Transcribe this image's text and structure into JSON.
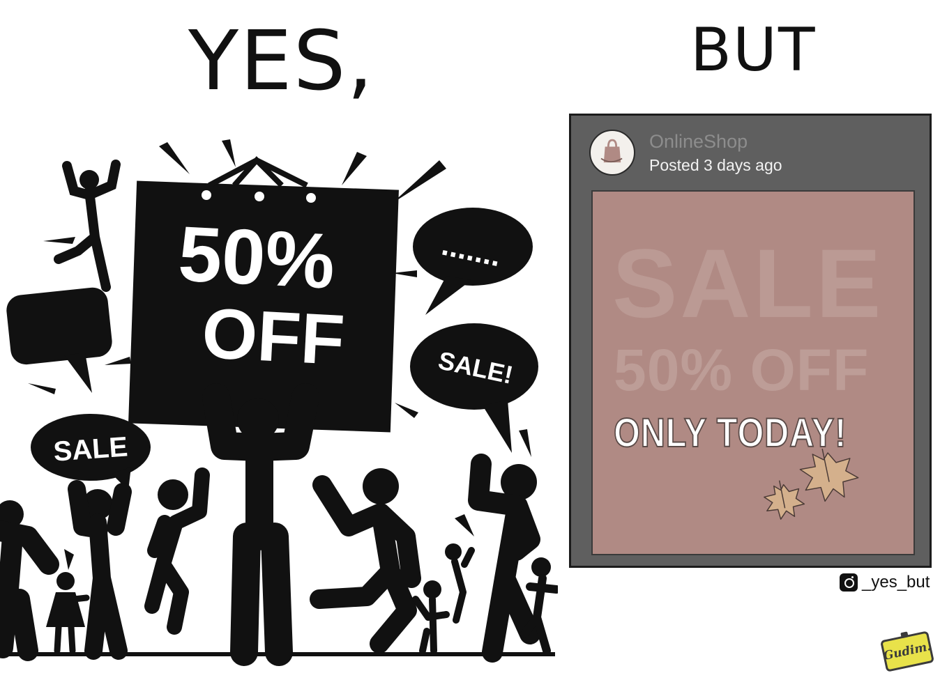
{
  "left": {
    "heading": "YES,",
    "bag_line1": "50%",
    "bag_line2": "OFF",
    "bubble_sale_left": "SALE",
    "bubble_sale_right": "SALE!",
    "bubble_dots": "......."
  },
  "right": {
    "heading": "BUT",
    "post": {
      "shop_name": "OnlineShop",
      "posted": "Posted 3 days ago",
      "image_line1": "SALE",
      "image_line2": "50% OFF",
      "image_line3": "ONLY TODAY!"
    },
    "credit_handle": "_yes_but",
    "credit_icon": "instagram-icon",
    "signature": "Gudim."
  },
  "colors": {
    "post_card_bg": "#5f5f5f",
    "post_image_bg": "#b08a84",
    "leaf": "#d4b08c",
    "signature_badge": "#e8e24a"
  }
}
